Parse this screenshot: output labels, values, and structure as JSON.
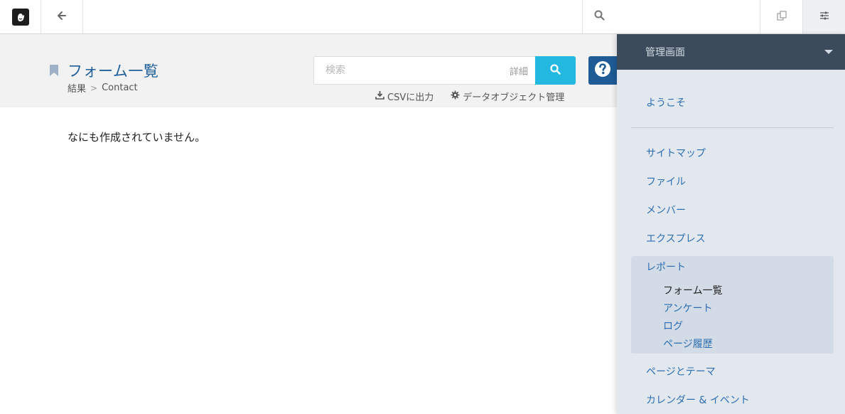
{
  "toolbar": {
    "logo_icon": "concrete5-hand-icon",
    "back_icon": "arrow-left-icon",
    "search_icon": "search-icon",
    "search_placeholder": "",
    "pages_icon": "copy-pages-icon",
    "settings_icon": "sliders-icon"
  },
  "header": {
    "title": "フォーム一覧",
    "breadcrumb": [
      "結果",
      "Contact"
    ],
    "breadcrumb_separator": ">",
    "search": {
      "placeholder": "検索",
      "advanced_label": "詳細"
    },
    "actions": [
      {
        "label": "CSVに出力",
        "icon": "download-icon"
      },
      {
        "label": "データオブジェクト管理",
        "icon": "gear-icon"
      }
    ]
  },
  "main": {
    "empty_message": "なにも作成されていません。"
  },
  "panel": {
    "title": "管理画面",
    "welcome": "ようこそ",
    "items": [
      "サイトマップ",
      "ファイル",
      "メンバー",
      "エクスプレス",
      "レポート"
    ],
    "reports_children": [
      "フォーム一覧",
      "アンケート",
      "ログ",
      "ページ履歴"
    ],
    "more_items": [
      "ページとテーマ",
      "カレンダー & イベント"
    ]
  },
  "colors": {
    "accent": "#22b8e0",
    "title_blue": "#1e5f99",
    "link_blue": "#2d6fb2",
    "panel_header": "#3b4b5b",
    "panel_bg": "#e3e8ee"
  }
}
